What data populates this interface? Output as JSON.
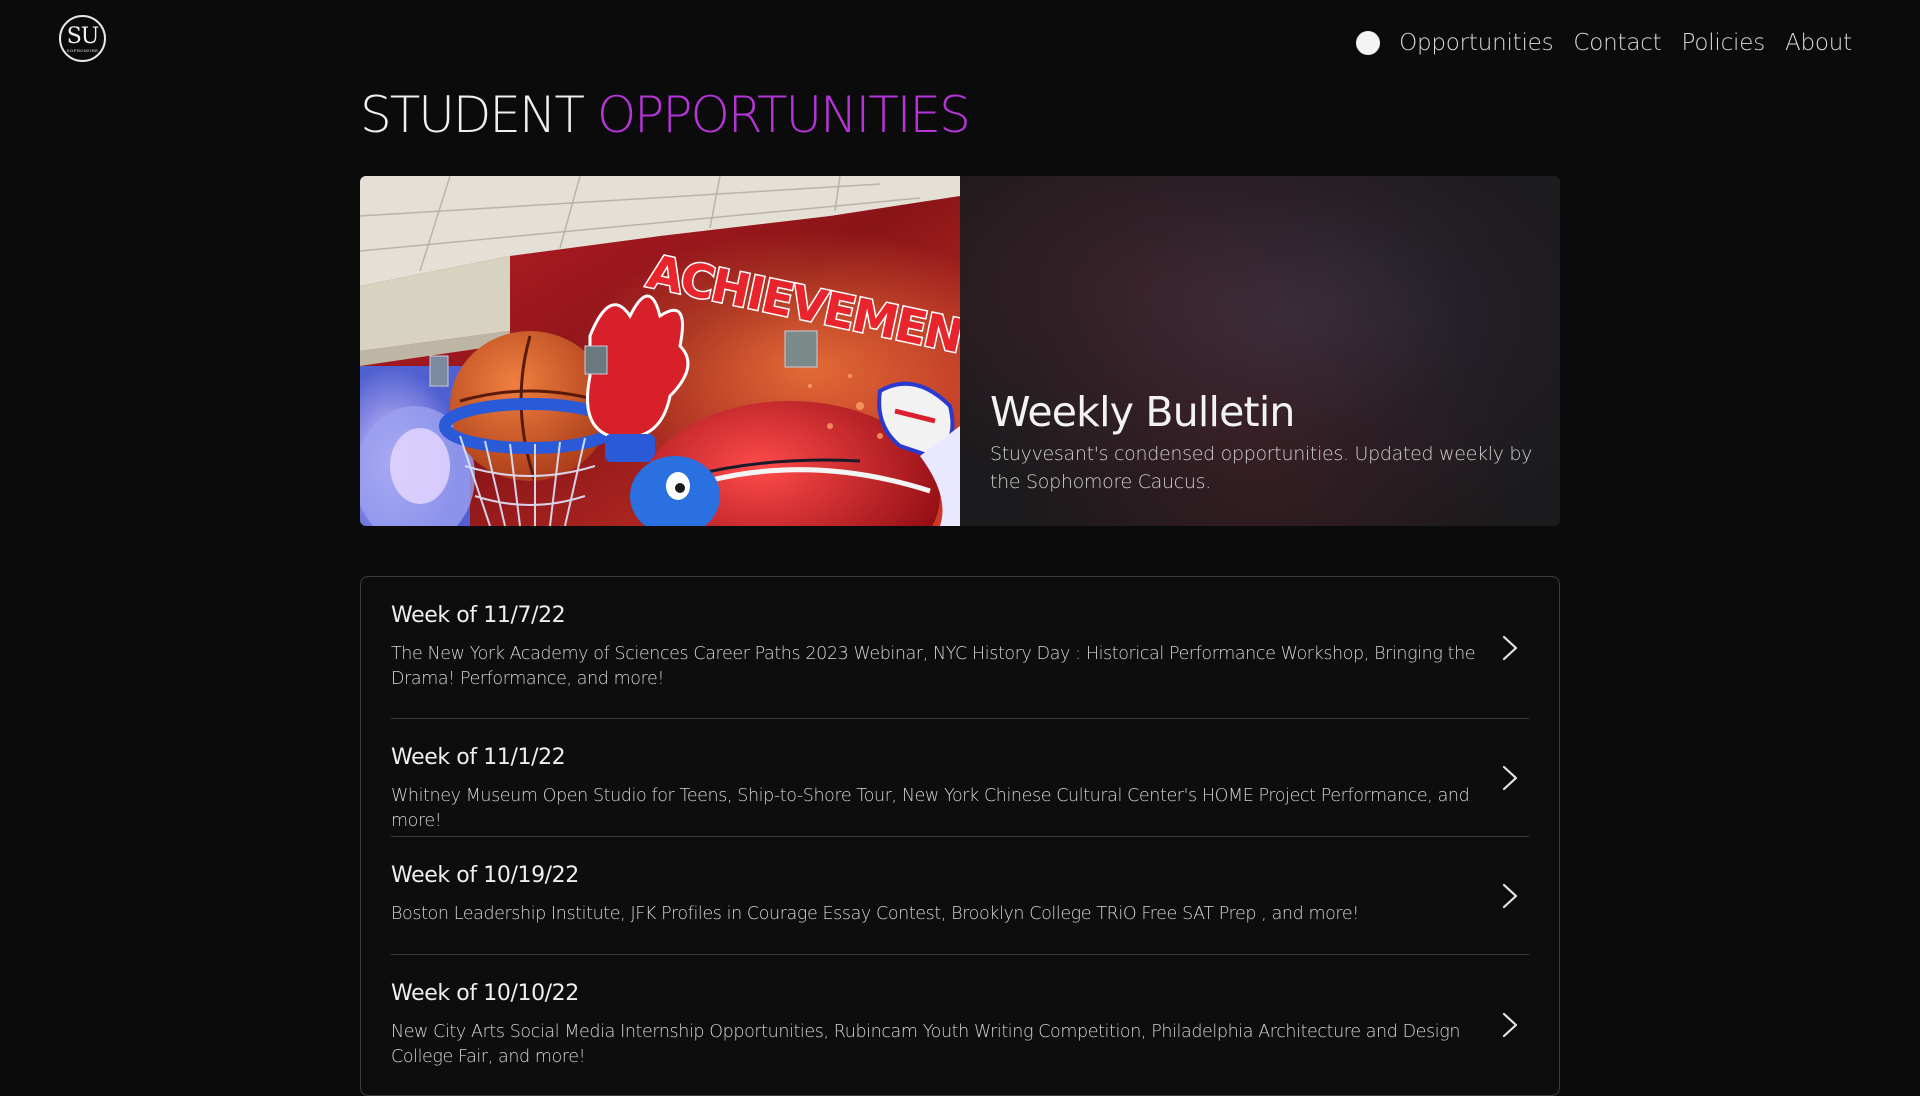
{
  "logo": {
    "main": "SU",
    "sub": "SOPHOMORE"
  },
  "nav": {
    "links": [
      "Opportunities",
      "Contact",
      "Policies",
      "About"
    ]
  },
  "page": {
    "title_plain": "STUDENT",
    "title_accent": "OPPORTUNITIES"
  },
  "hero": {
    "image_text": "ACHIEVEMENT",
    "title": "Weekly Bulletin",
    "description": "Stuyvesant's condensed opportunities. Updated weekly by the Sophomore Caucus."
  },
  "bulletins": [
    {
      "title": "Week of 11/7/22",
      "description": "The New York Academy of Sciences Career Paths 2023 Webinar, NYC History Day : Historical Performance Workshop, Bringing the Drama! Performance, and more!"
    },
    {
      "title": "Week of 11/1/22",
      "description": "Whitney Museum Open Studio for Teens, Ship-to-Shore Tour, New York Chinese Cultural Center's HOME Project Performance, and more!"
    },
    {
      "title": "Week of 10/19/22",
      "description": "Boston Leadership Institute, JFK Profiles in Courage Essay Contest, Brooklyn College TRiO Free SAT Prep , and more!"
    },
    {
      "title": "Week of 10/10/22",
      "description": "New City Arts Social Media Internship Opportunities, Rubincam Youth Writing Competition, Philadelphia Architecture and Design College Fair, and more!"
    }
  ],
  "colors": {
    "background": "#0b0b0b",
    "accent": "#b635d8",
    "card_border": "#3b3b3b"
  },
  "icons": {
    "logo": "su-logo-icon",
    "theme_toggle": "theme-toggle-icon",
    "row_arrow": "chevron-right-icon"
  }
}
